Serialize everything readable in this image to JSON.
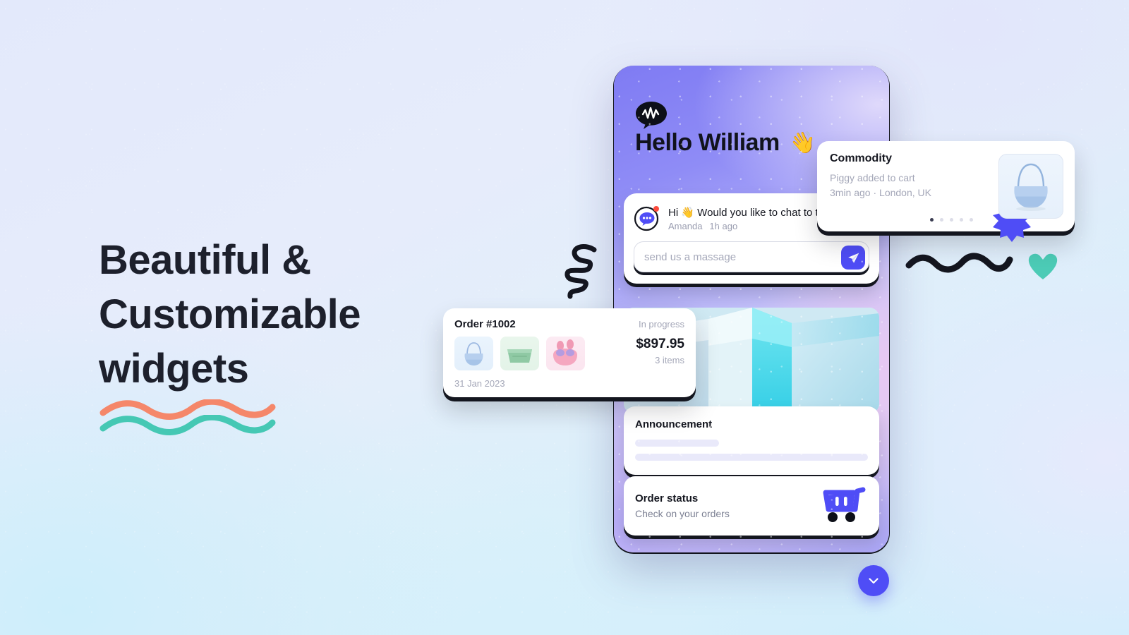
{
  "background": {
    "accent": "#4f4df6",
    "text_dark": "#14161f",
    "text_muted": "#a4a7b8",
    "squiggle_orange": "#f5876a",
    "squiggle_teal": "#45c8b4",
    "heart_color": "#4ccbb6"
  },
  "hero": {
    "line1": "Beautiful &",
    "line2": "Customizable",
    "line3": "widgets"
  },
  "phone": {
    "logo_icon": "chat-wave-logo-icon",
    "greeting": "Hello William",
    "greeting_emoji": "👋",
    "chat": {
      "avatar_icon": "chat-bubble-avatar-icon",
      "message": "Hi 👋 Would you like to chat to the",
      "sender": "Amanda",
      "time": "1h ago",
      "composer_placeholder": "send us a massage",
      "composer_value": "",
      "send_icon": "paper-plane-icon"
    },
    "announcement": {
      "title": "Announcement"
    },
    "order_status": {
      "title": "Order status",
      "subtitle": "Check on your orders",
      "icon": "shopping-cart-icon"
    }
  },
  "commodity": {
    "title": "Commodity",
    "subtitle": "Piggy added to cart",
    "meta": "3min ago · London, UK",
    "thumb_icon": "handbag-product-icon",
    "dots": [
      true,
      false,
      false,
      false,
      false
    ]
  },
  "order": {
    "id": "Order #1002",
    "state": "In progress",
    "price": "$897.95",
    "items": "3 items",
    "date": "31 Jan 2023",
    "thumbs": [
      "handbag-icon",
      "belt-bag-icon",
      "earbuds-icon"
    ]
  },
  "decor": {
    "spiral": "spiral-doodle-icon",
    "wavy_dark": "wavy-line-doodle-icon",
    "heart": "heart-icon",
    "scroll_down": "chevron-down-icon"
  }
}
